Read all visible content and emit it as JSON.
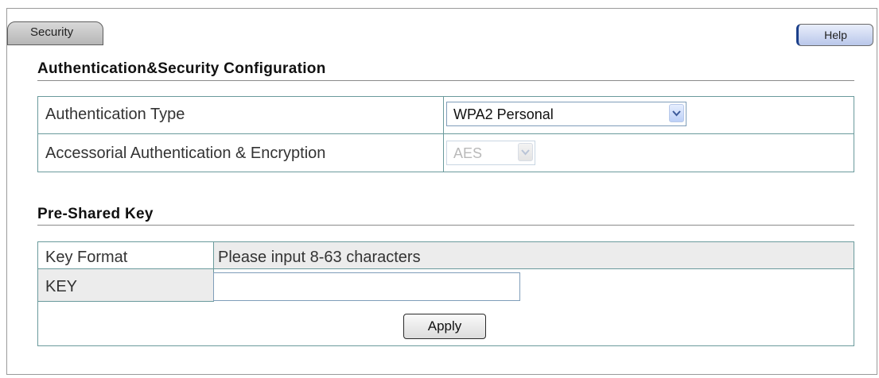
{
  "tab": {
    "label": "Security"
  },
  "help_button": {
    "label": "Help"
  },
  "auth_section": {
    "title": "Authentication&Security Configuration",
    "rows": [
      {
        "label": "Authentication Type",
        "value": "WPA2 Personal"
      },
      {
        "label": "Accessorial Authentication & Encryption",
        "value": "AES"
      }
    ]
  },
  "psk_section": {
    "title": "Pre-Shared Key",
    "key_format": {
      "label": "Key Format",
      "hint": "Please input 8-63 characters"
    },
    "key": {
      "label": "KEY",
      "value": ""
    },
    "apply_label": "Apply"
  },
  "icons": {
    "dropdown": "chevron-down-icon"
  }
}
